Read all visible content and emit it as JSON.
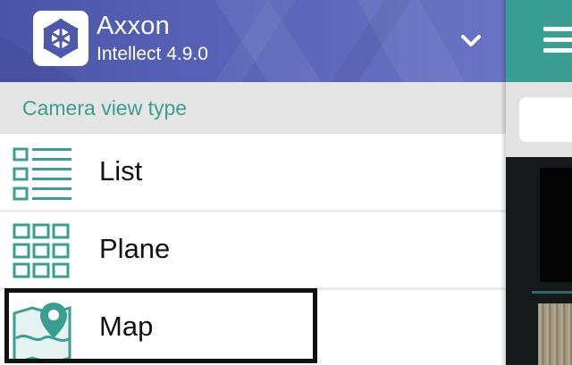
{
  "header": {
    "app_name": "Axxon",
    "version": "Intellect 4.9.0",
    "logo_icon": "axxon-logo-icon",
    "toggle_icon": "chevron-down-icon",
    "gradient": [
      "#4b55a8",
      "#6974c4"
    ]
  },
  "section": {
    "title": "Camera view type",
    "title_color": "#3a9f92",
    "background": "#e5e5e5"
  },
  "menu": {
    "selected": "Map",
    "items": [
      {
        "label": "List",
        "icon": "list-view-icon"
      },
      {
        "label": "Plane",
        "icon": "grid-view-icon"
      },
      {
        "label": "Map",
        "icon": "map-pin-icon"
      }
    ]
  },
  "background_app": {
    "toolbar_color": "#3a9f92",
    "menu_icon": "hamburger-menu-icon"
  }
}
